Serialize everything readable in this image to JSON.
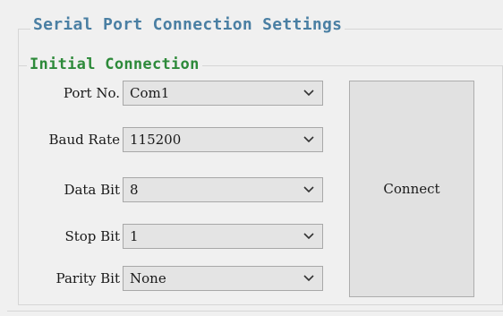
{
  "outer_group": {
    "title": "Serial Port Connection Settings"
  },
  "inner_group": {
    "title": "Initial Connection"
  },
  "fields": [
    {
      "label": "Port No.",
      "value": "Com1"
    },
    {
      "label": "Baud Rate",
      "value": "115200"
    },
    {
      "label": "Data Bit",
      "value": "8"
    },
    {
      "label": "Stop Bit",
      "value": "1"
    },
    {
      "label": "Parity Bit",
      "value": "None"
    }
  ],
  "connect_button": {
    "label": "Connect"
  },
  "icons": {
    "dropdown": "chevron-down-icon"
  },
  "colors": {
    "outer_title": "#4a7fa3",
    "inner_title": "#2d8a3a",
    "background": "#f0f0f0",
    "combo_bg": "#e4e4e4"
  }
}
